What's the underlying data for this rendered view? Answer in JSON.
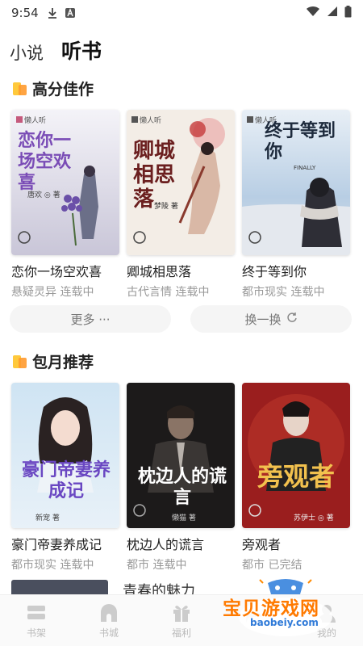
{
  "status_bar": {
    "time": "9:54"
  },
  "tabs": [
    {
      "label": "小说",
      "active": false
    },
    {
      "label": "听书",
      "active": true
    }
  ],
  "section1": {
    "title": "高分佳作",
    "books": [
      {
        "title": "恋你一场空欢喜",
        "meta": "悬疑灵异 连载中",
        "cover_text": "恋你一场空欢喜",
        "cover_author": "唐欢 ◎ 著",
        "cover_brand": "懒人听"
      },
      {
        "title": "卿城相思落",
        "meta": "古代言情 连载中",
        "cover_text": "卿城相思落",
        "cover_author": "梦陵 著",
        "cover_brand": "懒人听"
      },
      {
        "title": "终于等到你",
        "meta": "都市现实 连载中",
        "cover_text": "终于等到你",
        "cover_sub": "FINALLY",
        "cover_brand": "懒人听"
      }
    ],
    "more_label": "更多 ···",
    "refresh_label": "换一换"
  },
  "section2": {
    "title": "包月推荐",
    "books": [
      {
        "title": "豪门帝妻养成记",
        "meta": "都市现实 连载中",
        "cover_text": "豪门帝妻养成记",
        "cover_author": "新宠 著"
      },
      {
        "title": "枕边人的谎言",
        "meta": "都市 连载中",
        "cover_text": "枕边人的谎言",
        "cover_author": "懒猫 著"
      },
      {
        "title": "旁观者",
        "meta": "都市 已完结",
        "cover_text": "旁观者",
        "cover_author": "苏伊士 ◎ 著"
      }
    ],
    "partial_title": "青春的魅力"
  },
  "bottom_nav": [
    {
      "label": "书架",
      "icon": "bookshelf-icon"
    },
    {
      "label": "书城",
      "icon": "store-icon"
    },
    {
      "label": "福利",
      "icon": "gift-icon"
    },
    {
      "label": "",
      "icon": "watermark-covered"
    },
    {
      "label": "我的",
      "icon": "profile-icon"
    }
  ],
  "watermark": {
    "text": "宝贝游戏网",
    "url": "baobeiy.com"
  },
  "colors": {
    "accent": "#ff9a2e",
    "accent_light": "#ffc93c",
    "muted": "#999999"
  }
}
